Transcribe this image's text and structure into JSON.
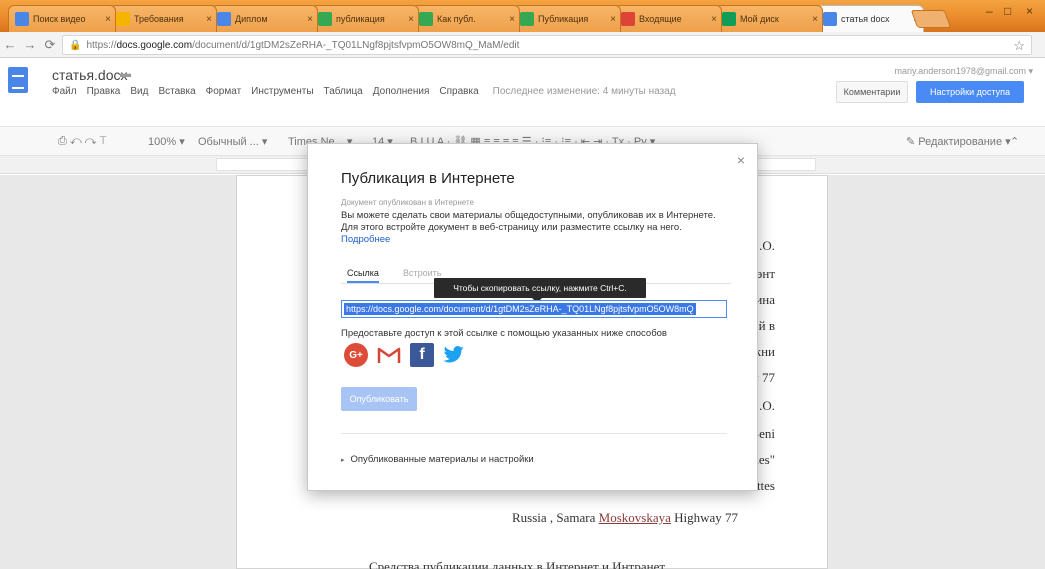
{
  "browser": {
    "tabs": [
      {
        "title": "Поиск видео",
        "color": "#4a86e8",
        "active": false
      },
      {
        "title": "Требования",
        "color": "#f4b400",
        "active": false
      },
      {
        "title": "Диплом",
        "color": "#4a86e8",
        "active": false
      },
      {
        "title": "публикация",
        "color": "#34a853",
        "active": false
      },
      {
        "title": "Как публ.",
        "color": "#34a853",
        "active": false
      },
      {
        "title": "Публикация",
        "color": "#34a853",
        "active": false
      },
      {
        "title": "Входящие",
        "color": "#db4437",
        "active": false
      },
      {
        "title": "Мой диск",
        "color": "#0f9d58",
        "active": false
      },
      {
        "title": "статья docx",
        "color": "#4a86e8",
        "active": true
      }
    ],
    "url_prefix": "https://",
    "url_host": "docs.google.com",
    "url_path": "/document/d/1gtDM2sZeRHA-_TQ01LNgf8pjtsfvpmO5OW8mQ_MaM/edit",
    "close_glyph": "×",
    "star_glyph": "☆",
    "lock_glyph": "🔒",
    "back_glyph": "←",
    "forward_glyph": "→",
    "reload_glyph": "⟳"
  },
  "docs": {
    "title": "статья.docx",
    "folder_glyph": "▬",
    "menu": [
      "Файл",
      "Правка",
      "Вид",
      "Вставка",
      "Формат",
      "Инструменты",
      "Таблица",
      "Дополнения",
      "Справка"
    ],
    "last_edit": "Последнее изменение: 4 минуты назад",
    "account": "mariy.anderson1978@gmail.com ▾",
    "comments_label": "Комментарии",
    "share_label": "Настройки доступа",
    "toolbar": {
      "print_undo": "⎙  ↶  ↷  ⊤",
      "zoom": "100%  ▾",
      "style": "Обычный ...  ▾",
      "font": "Times Ne...  ▾",
      "size": "14  ▾",
      "format": "B  I  U  A  ·  ⛓  ▦  ≡  ≡  ≡  ≡  ☰  ·  ⁝≡  ·  ⁝≡  ·  ⇤  ⇥  ·  Tx  ·  Ру  ▾",
      "mode": "✎  Редактирование  ▾",
      "collapse": "⌃"
    }
  },
  "page_text": {
    "right_lines": [
      ".O.",
      "энт",
      "ина",
      "й в",
      "кни",
      "у 77",
      ".O.",
      "Seni",
      "hes\"",
      "ttes"
    ],
    "address_line_prefix": "Russia , Samara ",
    "address_line_link": "Moskovskaya",
    "address_line_suffix": " Highway 77",
    "heading": "Средства публикации данных в Интернет и Интранет"
  },
  "dialog": {
    "title": "Публикация в Интернете",
    "status": "Документ опубликован в Интернете",
    "description": "Вы можете сделать свои материалы общедоступными, опубликовав их в Интернете. Для этого встройте документ в веб-страницу или разместите ссылку на него.",
    "more_link": "Подробнее",
    "tabs": {
      "link": "Ссылка",
      "embed": "Встроить"
    },
    "tooltip": "Чтобы скопировать ссылку, нажмите Ctrl+C.",
    "link_value": "https://docs.google.com/document/d/1gtDM2sZeRHA-_TQ01LNgf8pjtsfvpmO5OW8mQ",
    "share_text": "Предоставьте доступ к этой ссылке с помощью указанных ниже способов",
    "social": {
      "gplus": "G+",
      "facebook": "f"
    },
    "publish_label": "Опубликовать",
    "settings_label": "Опубликованные материалы и настройки",
    "settings_triangle": "▸",
    "close_glyph": "×"
  }
}
